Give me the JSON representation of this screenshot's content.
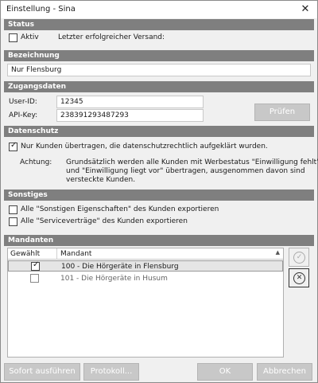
{
  "window": {
    "title": "Einstellung - Sina",
    "close_glyph": "✕"
  },
  "status": {
    "header": "Status",
    "aktiv_label": "Aktiv",
    "aktiv_checked": false,
    "last_send_label": "Letzter erfolgreicher Versand:"
  },
  "bezeichnung": {
    "header": "Bezeichnung",
    "value": "Nur Flensburg"
  },
  "zugangsdaten": {
    "header": "Zugangsdaten",
    "userid_label": "User-ID:",
    "userid_value": "12345",
    "apikey_label": "API-Key:",
    "apikey_value": "238391293487293",
    "check_button": "Prüfen"
  },
  "datenschutz": {
    "header": "Datenschutz",
    "only_informed_label": "Nur Kunden übertragen, die datenschutzrechtlich aufgeklärt wurden.",
    "only_informed_checked": true,
    "note_label": "Achtung:",
    "note_line1": "Grundsätzlich werden alle Kunden mit Werbestatus \"Einwilligung fehlt\"",
    "note_line2": "und \"Einwilligung liegt vor\" übertragen, ausgenommen davon sind",
    "note_line3": "versteckte Kunden."
  },
  "sonstiges": {
    "header": "Sonstiges",
    "opt1_label": "Alle \"Sonstigen Eigenschaften\" des Kunden exportieren",
    "opt1_checked": false,
    "opt2_label": "Alle \"Serviceverträge\" des Kunden exportieren",
    "opt2_checked": false
  },
  "mandanten": {
    "header": "Mandanten",
    "col_selected": "Gewählt",
    "col_mandant": "Mandant",
    "rows": [
      {
        "selected": true,
        "name": "100 - Die Hörgeräte in Flensburg"
      },
      {
        "selected": false,
        "name": "101 - Die Hörgeräte in Husum"
      }
    ],
    "sort_icon": "chevron-up-icon",
    "accept_icon": "check-circle-icon",
    "remove_icon": "x-circle-icon"
  },
  "footer": {
    "run_now": "Sofort ausführen",
    "protocol": "Protokoll...",
    "ok": "OK",
    "cancel": "Abbrechen"
  },
  "colors": {
    "section_header": "#7f7f7f",
    "disabled_button": "#c8c8c8",
    "selected_row": "#e5e5e5"
  }
}
